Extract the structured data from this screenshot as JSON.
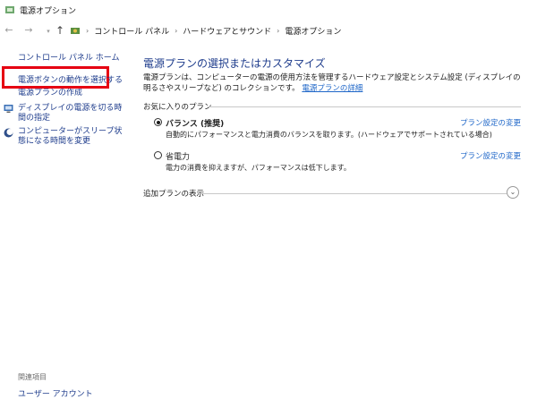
{
  "window": {
    "title": "電源オプション"
  },
  "nav": {
    "breadcrumbs": [
      "コントロール パネル",
      "ハードウェアとサウンド",
      "電源オプション"
    ]
  },
  "sidebar": {
    "home_link": "コントロール パネル ホーム",
    "items": [
      {
        "label": "電源ボタンの動作を選択する"
      },
      {
        "label": "電源プランの作成"
      },
      {
        "label": "ディスプレイの電源を切る時間の指定"
      },
      {
        "label": "コンピューターがスリープ状態になる時間を変更"
      }
    ],
    "related_title": "関連項目",
    "related_links": [
      "ユーザー アカウント"
    ]
  },
  "main": {
    "title": "電源プランの選択またはカスタマイズ",
    "description": "電源プランは、コンピューターの電源の使用方法を管理するハードウェア設定とシステム設定 (ディスプレイの明るさやスリープなど) のコレクションです。",
    "details_link": "電源プランの詳細",
    "preferred_section": "お気に入りのプラン",
    "plans": [
      {
        "name": "バランス (推奨)",
        "selected": true,
        "description": "自動的にパフォーマンスと電力消費のバランスを取ります。(ハードウェアでサポートされている場合)",
        "settings_link": "プラン設定の変更"
      },
      {
        "name": "省電力",
        "selected": false,
        "description": "電力の消費を抑えますが、パフォーマンスは低下します。",
        "settings_link": "プラン設定の変更"
      }
    ],
    "additional_section": "追加プランの表示"
  },
  "colors": {
    "link": "#1e3c8c",
    "accent_link": "#1e66c8",
    "highlight": "#e60012"
  }
}
